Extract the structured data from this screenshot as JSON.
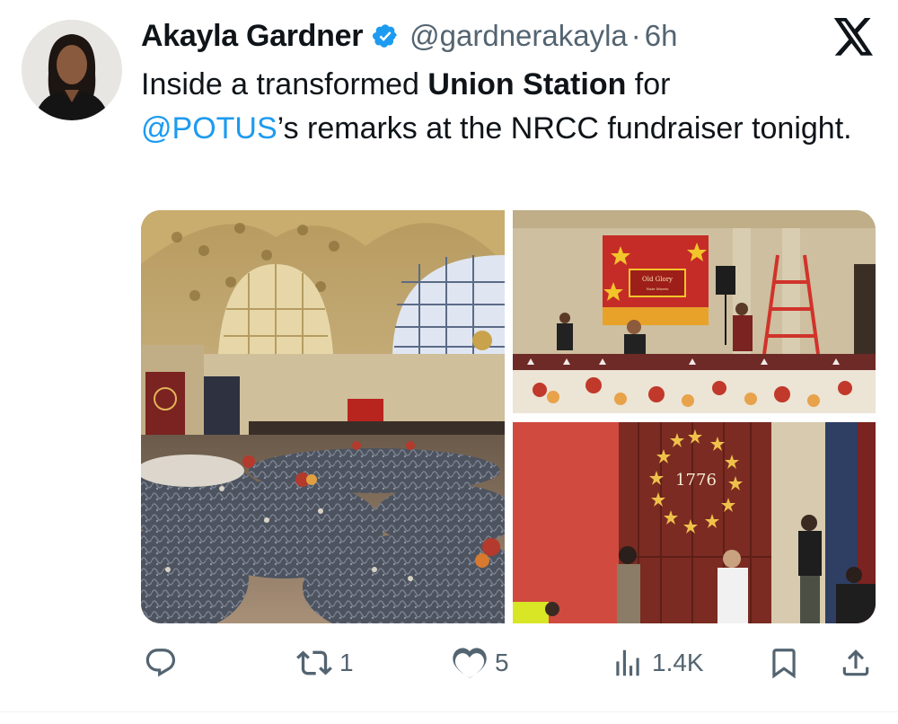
{
  "author": {
    "name": "Akayla Gardner",
    "handle": "@gardnerakayla",
    "separator": "·",
    "time": "6h",
    "verified": true,
    "verified_color": "#1d9bf0"
  },
  "tweet": {
    "text_part1": "Inside a transformed ",
    "text_bold": "Union Station",
    "text_part2": " for",
    "mention": "@POTUS",
    "text_part3": "’s remarks at the NRCC fundraiser tonight."
  },
  "media": {
    "sign_text": "Old Glory",
    "sign_subtext": "Nate Morris",
    "door_year": "1776"
  },
  "actions": {
    "reply": {
      "icon": "reply-icon",
      "count": ""
    },
    "retweet": {
      "icon": "retweet-icon",
      "count": "1"
    },
    "like": {
      "icon": "heart-icon",
      "count": "5"
    },
    "views": {
      "icon": "views-icon",
      "count": "1.4K"
    },
    "bookmark": {
      "icon": "bookmark-icon"
    },
    "share": {
      "icon": "share-icon"
    }
  },
  "colors": {
    "text": "#0f1419",
    "secondary": "#536471",
    "link": "#1d9bf0"
  }
}
